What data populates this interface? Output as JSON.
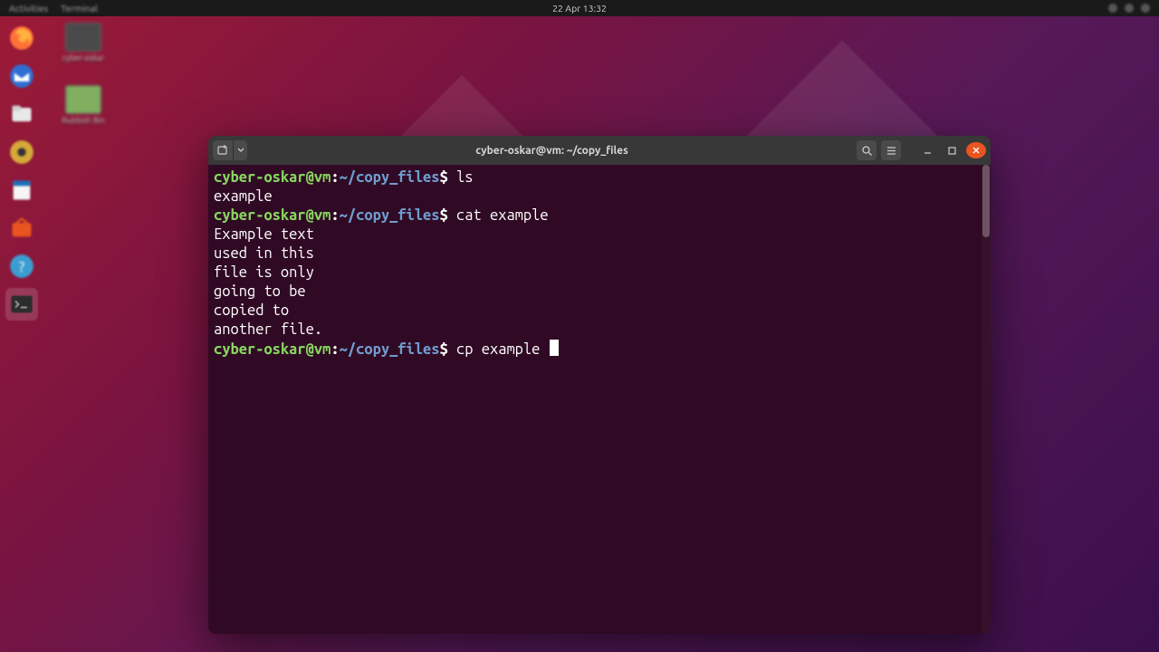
{
  "topbar": {
    "activities": "Activities",
    "app": "Terminal",
    "datetime": "22 Apr  13:32"
  },
  "desktop": {
    "icons": [
      {
        "label": "cyber-oskar"
      },
      {
        "label": "Rubbish Bin"
      }
    ]
  },
  "dock": {
    "items": [
      "firefox-icon",
      "thunderbird-icon",
      "files-icon",
      "rhythmbox-icon",
      "libreoffice-writer-icon",
      "software-icon",
      "help-icon",
      "terminal-icon"
    ]
  },
  "terminal": {
    "title": "cyber-oskar@vm: ~/copy_files",
    "prompt_user_host": "cyber-oskar@vm",
    "prompt_path": "~/copy_files",
    "lines": {
      "cmd1": "ls",
      "out1": "example",
      "cmd2": "cat example",
      "out2_1": "Example text",
      "out2_2": "used in this",
      "out2_3": "file is only",
      "out2_4": "going to be",
      "out2_5": "copied to",
      "out2_6": "another file.",
      "cmd3": "cp example "
    }
  }
}
